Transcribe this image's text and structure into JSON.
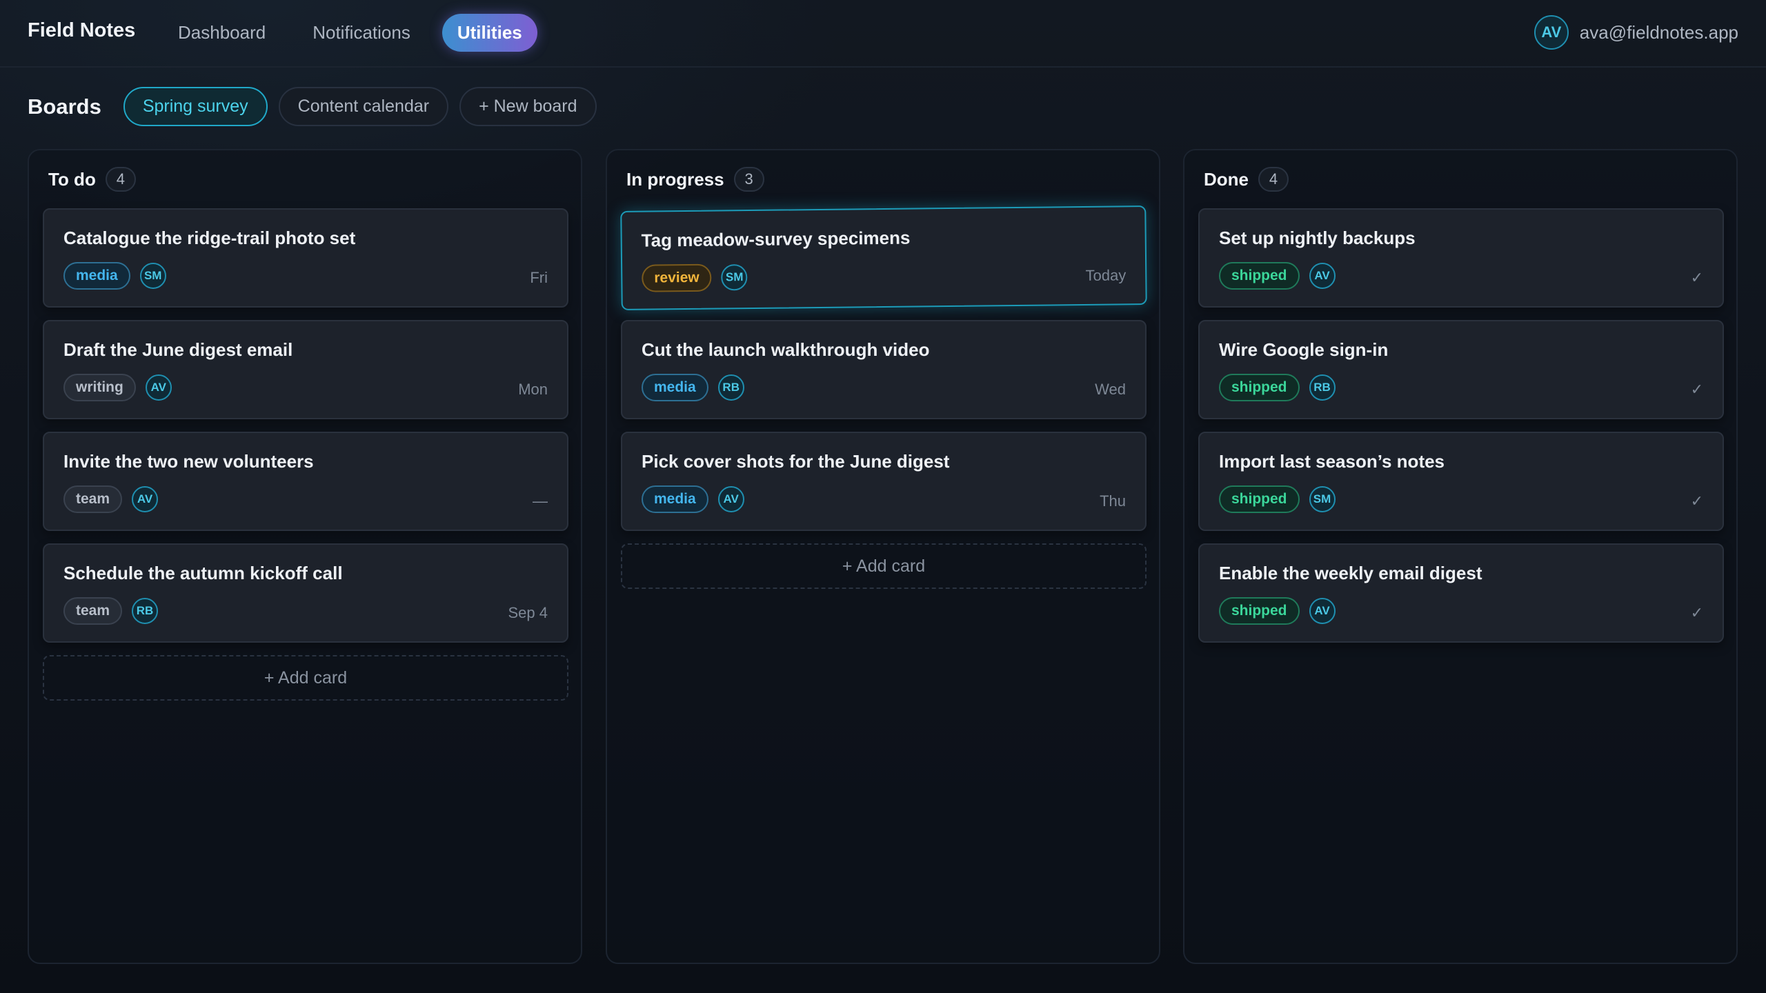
{
  "app": {
    "brand": "Field Notes"
  },
  "nav": {
    "items": [
      {
        "label": "Dashboard",
        "active": false
      },
      {
        "label": "Notifications",
        "active": false
      },
      {
        "label": "Utilities",
        "active": true
      }
    ]
  },
  "user": {
    "initials": "AV",
    "email": "ava@fieldnotes.app"
  },
  "boards": {
    "title": "Boards",
    "pills": [
      {
        "label": "Spring survey",
        "active": true
      },
      {
        "label": "Content calendar",
        "active": false
      },
      {
        "label": "+ New board",
        "active": false
      }
    ]
  },
  "columns": [
    {
      "title": "To do",
      "count": "4",
      "cards": [
        {
          "title": "Catalogue the ridge-trail photo set",
          "tag": "media",
          "assignee": "SM",
          "due": "Fri"
        },
        {
          "title": "Draft the June digest email",
          "tag": "writing",
          "assignee": "AV",
          "due": "Mon"
        },
        {
          "title": "Invite the two new volunteers",
          "tag": "team",
          "assignee": "AV",
          "due": "—"
        },
        {
          "title": "Schedule the autumn kickoff call",
          "tag": "team",
          "assignee": "RB",
          "due": "Sep 4"
        }
      ],
      "add_label": "+ Add card"
    },
    {
      "title": "In progress",
      "count": "3",
      "cards": [
        {
          "title": "Tag meadow-survey specimens",
          "tag": "review",
          "assignee": "SM",
          "due": "Today"
        },
        {
          "title": "Cut the launch walkthrough video",
          "tag": "media",
          "assignee": "RB",
          "due": "Wed"
        },
        {
          "title": "Pick cover shots for the June digest",
          "tag": "media",
          "assignee": "AV",
          "due": "Thu"
        }
      ],
      "add_label": "+ Add card"
    },
    {
      "title": "Done",
      "count": "4",
      "cards": [
        {
          "title": "Set up nightly backups",
          "tag": "shipped",
          "assignee": "AV",
          "due": "✓"
        },
        {
          "title": "Wire Google sign-in",
          "tag": "shipped",
          "assignee": "RB",
          "due": "✓"
        },
        {
          "title": "Import last season’s notes",
          "tag": "shipped",
          "assignee": "SM",
          "due": "✓"
        },
        {
          "title": "Enable the weekly email digest",
          "tag": "shipped",
          "assignee": "AV",
          "due": "✓"
        }
      ]
    }
  ]
}
